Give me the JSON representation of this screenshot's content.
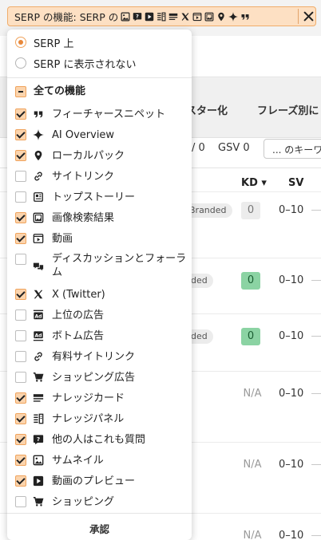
{
  "filter_chip": {
    "label": "SERP の機能: SERP の",
    "icons": [
      "image-icon",
      "question-icon",
      "video-icon",
      "panel-icon",
      "card-icon",
      "x-icon",
      "video-preview-icon",
      "gallery-icon",
      "pin-icon",
      "sparkle-icon",
      "quote-icon"
    ],
    "close_label": "✕"
  },
  "radio_options": [
    {
      "label": "SERP 上",
      "selected": true
    },
    {
      "label": "SERP に表示されない",
      "selected": false
    }
  ],
  "all_features": {
    "label": "全ての機能",
    "state": "indeterminate"
  },
  "features": [
    {
      "label": "フィーチャースニペット",
      "icon": "quote-icon",
      "checked": true
    },
    {
      "label": "AI Overview",
      "icon": "sparkle-icon",
      "checked": true
    },
    {
      "label": "ローカルパック",
      "icon": "pin-icon",
      "checked": true
    },
    {
      "label": "サイトリンク",
      "icon": "link-icon",
      "checked": false
    },
    {
      "label": "トップストーリー",
      "icon": "news-icon",
      "checked": false
    },
    {
      "label": "画像検索結果",
      "icon": "gallery-icon",
      "checked": true
    },
    {
      "label": "動画",
      "icon": "video-box-icon",
      "checked": true
    },
    {
      "label": "ディスカッションとフォーラム",
      "icon": "chat-icon",
      "checked": false
    },
    {
      "label": "X (Twitter)",
      "icon": "x-icon",
      "checked": true
    },
    {
      "label": "上位の広告",
      "icon": "ad-top-icon",
      "checked": false
    },
    {
      "label": "ボトム広告",
      "icon": "ad-bottom-icon",
      "checked": false
    },
    {
      "label": "有料サイトリンク",
      "icon": "link-icon",
      "checked": false
    },
    {
      "label": "ショッピング広告",
      "icon": "cart-icon",
      "checked": false
    },
    {
      "label": "ナレッジカード",
      "icon": "card-icon",
      "checked": true
    },
    {
      "label": "ナレッジパネル",
      "icon": "panel-icon",
      "checked": true
    },
    {
      "label": "他の人はこれも質問",
      "icon": "question-icon",
      "checked": true
    },
    {
      "label": "サムネイル",
      "icon": "image-icon",
      "checked": true
    },
    {
      "label": "動画のプレビュー",
      "icon": "video-icon",
      "checked": true
    },
    {
      "label": "ショッピング",
      "icon": "cart-icon",
      "checked": false
    }
  ],
  "approve_label": "承認",
  "background": {
    "tab_cluster": "スター化",
    "tab_phrase": "フレーズ別に",
    "metric_a": "/ 0",
    "metric_gsv": "GSV 0",
    "keyword_button": "... のキーワ",
    "col_kd": "KD ▾",
    "col_sv": "SV",
    "rows": [
      {
        "badge": "Branded",
        "kd": "0",
        "kd_style": "gray",
        "sv": "0–10"
      },
      {
        "badge": "ded",
        "kd": "0",
        "kd_style": "green",
        "sv": "0–10"
      },
      {
        "badge": "ded",
        "kd": "0",
        "kd_style": "green",
        "sv": "0–10"
      },
      {
        "badge": "",
        "kd": "N/A",
        "kd_style": "na",
        "sv": "0–10"
      },
      {
        "badge": "",
        "kd": "N/A",
        "kd_style": "na",
        "sv": "0–10"
      },
      {
        "badge": "",
        "kd": "N/A",
        "kd_style": "na",
        "sv": "0–10"
      }
    ]
  },
  "colors": {
    "accent": "#e8883a",
    "chip_bg": "#fde0c3",
    "kd_green": "#8bd3a3"
  }
}
